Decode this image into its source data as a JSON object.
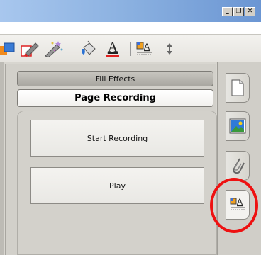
{
  "window": {
    "buttons": [
      {
        "name": "minimize",
        "glyph": "_"
      },
      {
        "name": "restore",
        "glyph": "❐"
      },
      {
        "name": "close",
        "glyph": "✕"
      }
    ]
  },
  "toolbar": {
    "icons": [
      "shape-icon",
      "eraser-icon",
      "magic-pen-icon",
      "fill-bucket-icon",
      "text-color-icon",
      "table-text-icon",
      "vertical-resize-icon"
    ],
    "text_color_glyph": "A"
  },
  "panel": {
    "tabs": {
      "fill_effects": "Fill Effects",
      "page_recording": "Page Recording"
    },
    "buttons": {
      "start_recording": "Start Recording",
      "play": "Play"
    }
  },
  "sidebar": {
    "tabs": [
      "page-sorter-icon",
      "gallery-icon",
      "attachments-icon",
      "properties-icon"
    ],
    "highlight_color": "#ee1111"
  },
  "colors": {
    "titlebar": "#8ab0e0",
    "panel_bg": "#d2d0ca"
  }
}
